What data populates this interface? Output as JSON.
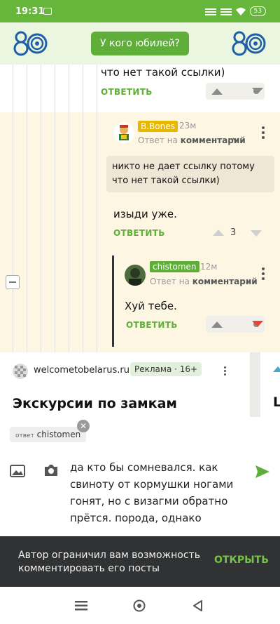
{
  "status_bar": {
    "time": "19:31",
    "battery": "53"
  },
  "header": {
    "logo": "80",
    "jubilee_button": "У кого юбилей?"
  },
  "comments": {
    "prev_text": "что нет такой ссылки)",
    "prev_reply": "ОТВЕТИТЬ",
    "bbones": {
      "nick": "B.Bones",
      "time": "23м",
      "reply_prefix": "Ответ на",
      "reply_target": "комментарий",
      "quote": "никто не дает ссылку потому что нет такой ссылки)",
      "text": "изыди уже.",
      "reply": "ОТВЕТИТЬ",
      "score": "3"
    },
    "chistomen": {
      "nick": "chistomen",
      "time": "12м",
      "reply_prefix": "Ответ на",
      "reply_target": "комментарий",
      "text": "Хуй тебе.",
      "reply": "ОТВЕТИТЬ"
    }
  },
  "ad": {
    "site": "welcometobelarus.ru",
    "badge": "Реклама · 16+",
    "title": "Экскурсии по замкам",
    "title2_partial": "L"
  },
  "compose": {
    "reply_label": "ответ",
    "reply_user": "chistomen",
    "text": "да кто бы сомневался. как свиноту от кормушки ногами гонят, но с визагми обратно прётся. порода, однако"
  },
  "toast": {
    "message": "Автор ограничил вам возможность комментировать его посты",
    "action": "ОТКРЫТЬ"
  },
  "colors": {
    "brand_green": "#5fae3a",
    "status_green": "#66b63c",
    "downvote_red": "#e4473b",
    "beige": "#fcf6e3"
  },
  "icons": [
    "camera-icon",
    "signal-icon",
    "wifi-icon",
    "battery-icon",
    "logo-80-icon",
    "upvote-icon",
    "downvote-icon",
    "more-icon",
    "chevron-down-icon",
    "image-icon",
    "camera-attach-icon",
    "send-icon",
    "close-icon",
    "menu-icon",
    "home-icon",
    "back-icon"
  ]
}
